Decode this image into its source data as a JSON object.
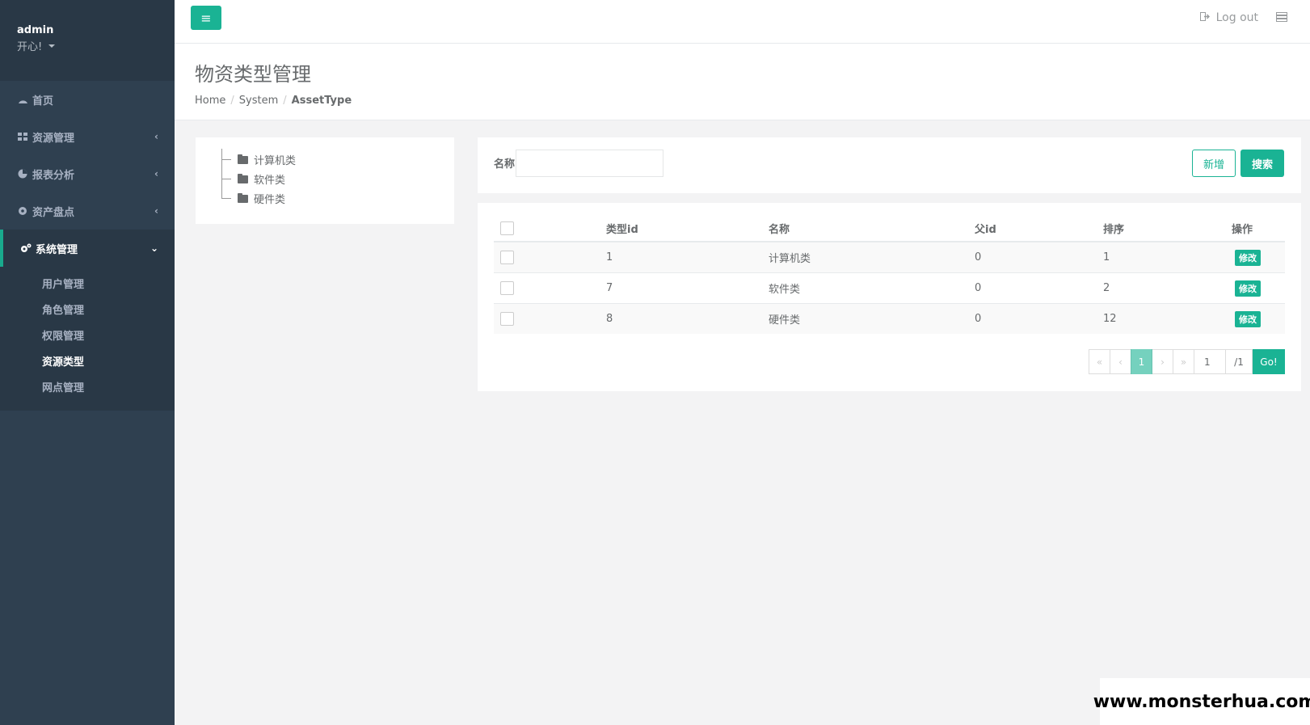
{
  "sidebar": {
    "profile": {
      "name": "admin",
      "status": "开心!"
    },
    "items": [
      {
        "label": "首页"
      },
      {
        "label": "资源管理"
      },
      {
        "label": "报表分析"
      },
      {
        "label": "资产盘点"
      },
      {
        "label": "系统管理"
      }
    ],
    "sub_items": [
      {
        "label": "用户管理"
      },
      {
        "label": "角色管理"
      },
      {
        "label": "权限管理"
      },
      {
        "label": "资源类型"
      },
      {
        "label": "网点管理"
      }
    ]
  },
  "topbar": {
    "logout_label": "Log out"
  },
  "heading": {
    "title": "物资类型管理",
    "breadcrumb": [
      "Home",
      "System",
      "AssetType"
    ]
  },
  "tree": {
    "nodes": [
      "计算机类",
      "软件类",
      "硬件类"
    ]
  },
  "search": {
    "label": "名称",
    "value": "",
    "add_label": "新增",
    "search_label": "搜索"
  },
  "table": {
    "columns": [
      "类型id",
      "名称",
      "父id",
      "排序",
      "操作"
    ],
    "rows": [
      {
        "id": "1",
        "name": "计算机类",
        "parent": "0",
        "order": "1",
        "action": "修改"
      },
      {
        "id": "7",
        "name": "软件类",
        "parent": "0",
        "order": "2",
        "action": "修改"
      },
      {
        "id": "8",
        "name": "硬件类",
        "parent": "0",
        "order": "12",
        "action": "修改"
      }
    ]
  },
  "pagination": {
    "first": "«",
    "prev": "‹",
    "current": "1",
    "next": "›",
    "last": "»",
    "page_input": "1",
    "total": "/1",
    "go": "Go!"
  },
  "watermark": "www.monsterhua.com",
  "colors": {
    "accent": "#1ab394",
    "sidebar": "#2f4050"
  }
}
